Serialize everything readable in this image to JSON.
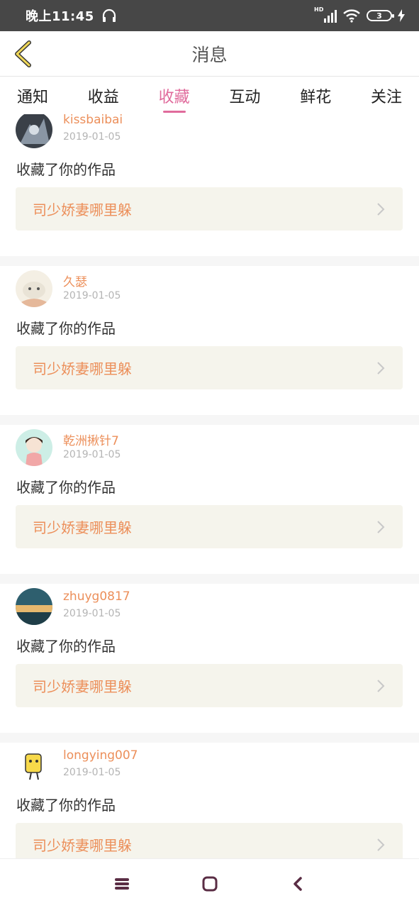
{
  "status_bar": {
    "time": "晚上11:45",
    "hd_label": "HD",
    "battery_level": "3"
  },
  "header": {
    "title": "消息"
  },
  "tabs": [
    {
      "label": "通知",
      "active": false
    },
    {
      "label": "收益",
      "active": false
    },
    {
      "label": "收藏",
      "active": true
    },
    {
      "label": "互动",
      "active": false
    },
    {
      "label": "鲜花",
      "active": false
    },
    {
      "label": "关注",
      "active": false
    }
  ],
  "messages": [
    {
      "user": "kissbaibai",
      "date": "2019-01-05",
      "text": "收藏了你的作品",
      "work": "司少娇妻哪里躲"
    },
    {
      "user": "久瑟",
      "date": "2019-01-05",
      "text": "收藏了你的作品",
      "work": "司少娇妻哪里躲"
    },
    {
      "user": "乾洲揪针7",
      "date": "2019-01-05",
      "text": "收藏了你的作品",
      "work": "司少娇妻哪里躲"
    },
    {
      "user": "zhuyg0817",
      "date": "2019-01-05",
      "text": "收藏了你的作品",
      "work": "司少娇妻哪里躲"
    },
    {
      "user": "longying007",
      "date": "2019-01-05",
      "text": "收藏了你的作品",
      "work": "司少娇妻哪里躲"
    }
  ],
  "colors": {
    "accent": "#e06b9c",
    "username": "#ec8f5a",
    "back_arrow": "#f0d858"
  }
}
